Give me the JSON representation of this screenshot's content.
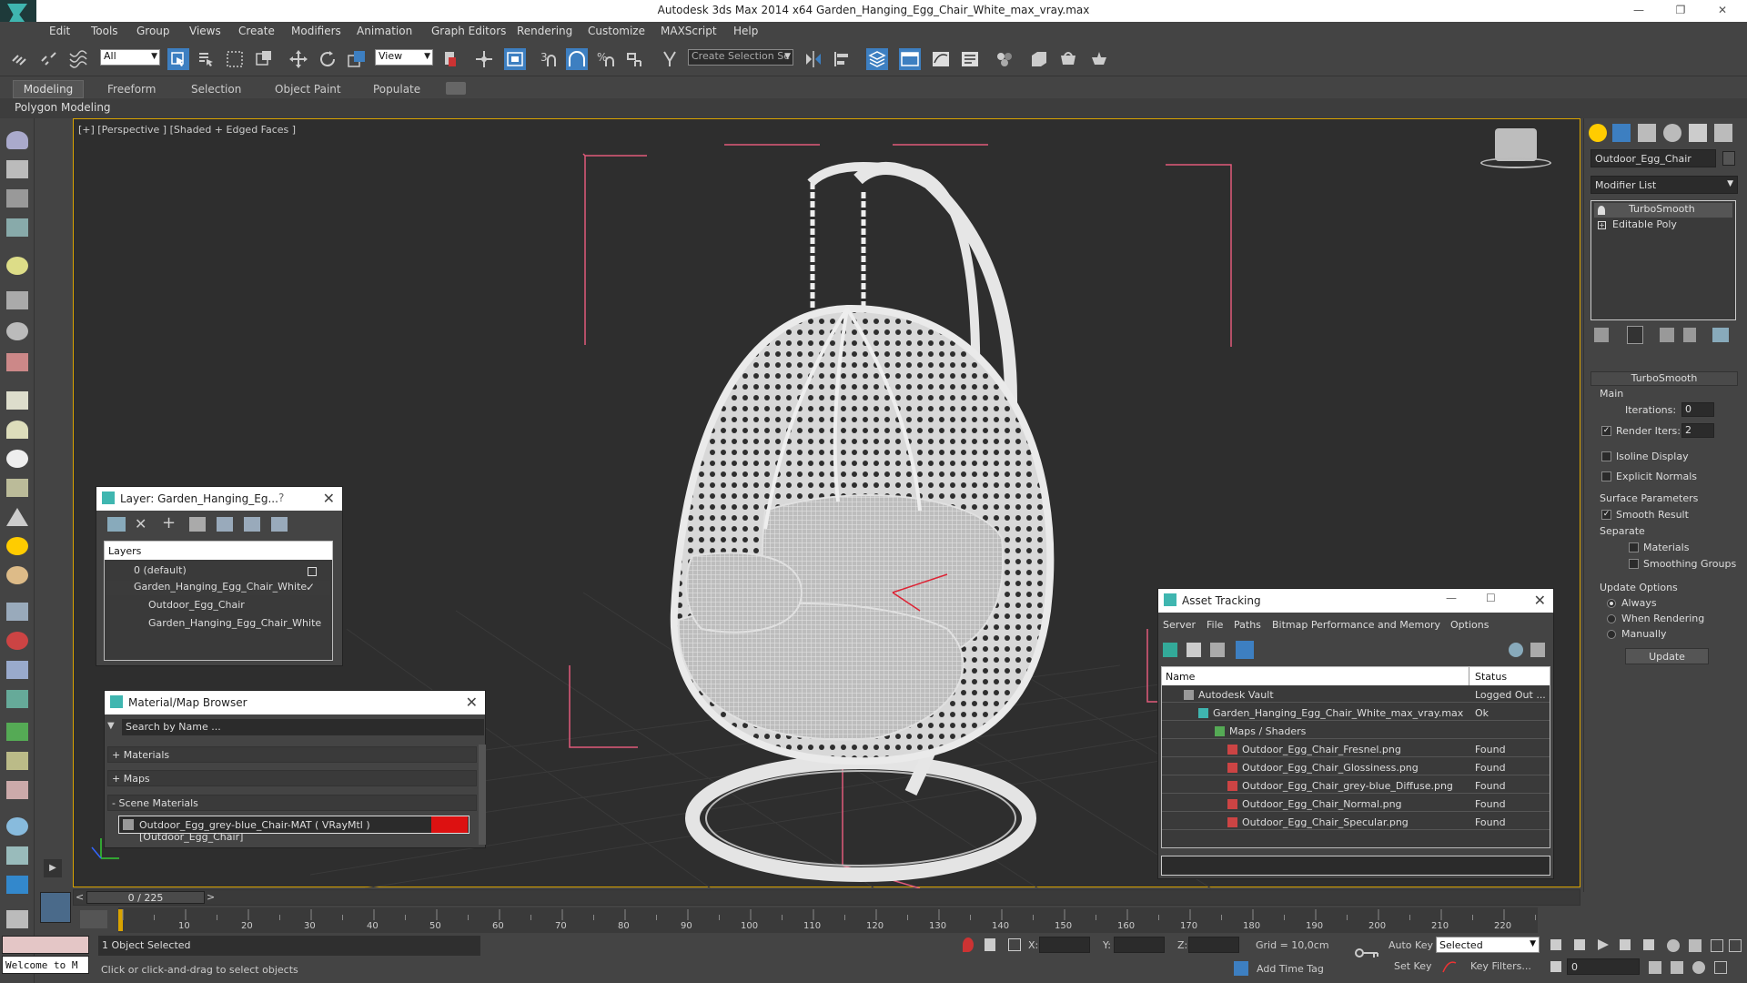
{
  "window": {
    "title": "Autodesk 3ds Max  2014 x64      Garden_Hanging_Egg_Chair_White_max_vray.max",
    "minimize": "—",
    "restore": "❐",
    "close": "✕"
  },
  "menu": [
    "Edit",
    "Tools",
    "Group",
    "Views",
    "Create",
    "Modifiers",
    "Animation",
    "Graph Editors",
    "Rendering",
    "Customize",
    "MAXScript",
    "Help"
  ],
  "toolbar": {
    "filter_combo": "All",
    "coord_combo": "View",
    "selection_set_placeholder": "Create Selection Se",
    "snap_3": "3",
    "snap_pct": "%"
  },
  "ribbon": {
    "tabs": [
      "Modeling",
      "Freeform",
      "Selection",
      "Object Paint",
      "Populate"
    ],
    "subtitle": "Polygon Modeling"
  },
  "viewport": {
    "label": "[+] [Perspective ] [Shaded + Edged Faces ]"
  },
  "command_panel": {
    "object_name": "Outdoor_Egg_Chair",
    "modifier_list": "Modifier List",
    "stack": [
      "TurboSmooth",
      "Editable Poly"
    ],
    "rollout_title": "TurboSmooth",
    "main_group": "Main",
    "iterations_label": "Iterations:",
    "iterations_value": "0",
    "render_iters_label": "Render Iters:",
    "render_iters_value": "2",
    "render_iters_checked": true,
    "isoline_label": "Isoline Display",
    "explicit_normals_label": "Explicit Normals",
    "surface_params": "Surface Parameters",
    "smooth_result_label": "Smooth Result",
    "separate_label": "Separate",
    "materials_label": "Materials",
    "smoothing_groups_label": "Smoothing Groups",
    "update_options": "Update Options",
    "radio_always": "Always",
    "radio_when_rendering": "When Rendering",
    "radio_manually": "Manually",
    "update_button": "Update"
  },
  "layer_panel": {
    "title": "Layer: Garden_Hanging_Eg...",
    "help": "?",
    "close": "✕",
    "header": "Layers",
    "rows": [
      "0 (default)",
      "Garden_Hanging_Egg_Chair_White",
      "Outdoor_Egg_Chair",
      "Garden_Hanging_Egg_Chair_White"
    ],
    "check": "✓"
  },
  "material_browser": {
    "title": "Material/Map Browser",
    "close": "✕",
    "search_placeholder": "Search by Name ...",
    "groups": [
      "+ Materials",
      "+ Maps",
      "- Scene Materials"
    ],
    "item": "Outdoor_Egg_grey-blue_Chair-MAT ( VRayMtl ) [Outdoor_Egg_Chair]"
  },
  "asset_tracking": {
    "title": "Asset Tracking",
    "menus": [
      "Server",
      "File",
      "Paths",
      "Bitmap Performance and Memory",
      "Options"
    ],
    "col_name": "Name",
    "col_status": "Status",
    "rows": [
      {
        "name": "Autodesk Vault",
        "status": "Logged Out ..."
      },
      {
        "name": "Garden_Hanging_Egg_Chair_White_max_vray.max",
        "status": "Ok"
      },
      {
        "name": "Maps / Shaders",
        "status": ""
      },
      {
        "name": "Outdoor_Egg_Chair_Fresnel.png",
        "status": "Found"
      },
      {
        "name": "Outdoor_Egg_Chair_Glossiness.png",
        "status": "Found"
      },
      {
        "name": "Outdoor_Egg_Chair_grey-blue_Diffuse.png",
        "status": "Found"
      },
      {
        "name": "Outdoor_Egg_Chair_Normal.png",
        "status": "Found"
      },
      {
        "name": "Outdoor_Egg_Chair_Specular.png",
        "status": "Found"
      }
    ]
  },
  "timeline": {
    "frame_counter": "0 / 225",
    "ticks": [
      "10",
      "20",
      "30",
      "40",
      "50",
      "60",
      "70",
      "80",
      "90",
      "100",
      "110",
      "120",
      "130",
      "140",
      "150",
      "160",
      "170",
      "180",
      "190",
      "200",
      "210",
      "220"
    ]
  },
  "status": {
    "objects_selected": "1 Object Selected",
    "hint": "Click or click-and-drag to select objects",
    "welcome": "Welcome to M",
    "x_label": "X:",
    "y_label": "Y:",
    "z_label": "Z:",
    "grid": "Grid = 10,0cm",
    "add_time_tag": "Add Time Tag",
    "auto_key": "Auto Key",
    "set_key": "Set Key",
    "selected_combo": "Selected",
    "key_filters": "Key Filters...",
    "frame_value": "0"
  }
}
